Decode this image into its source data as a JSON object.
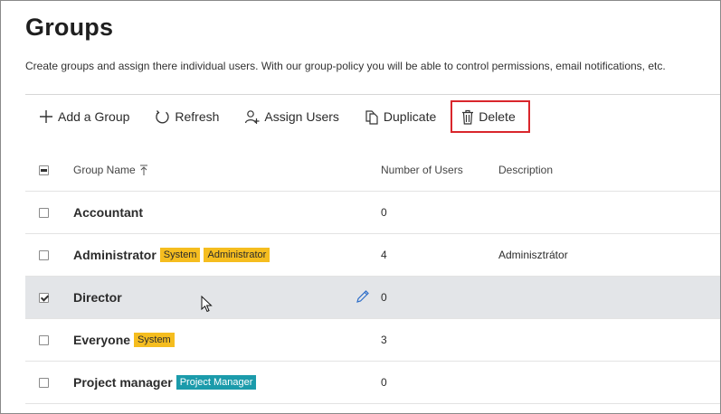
{
  "page": {
    "title": "Groups",
    "subtitle": "Create groups and assign there individual users. With our group-policy you will be able to control permissions, email notifications, etc."
  },
  "toolbar": {
    "add_label": "Add a Group",
    "refresh_label": "Refresh",
    "assign_label": "Assign Users",
    "duplicate_label": "Duplicate",
    "delete_label": "Delete"
  },
  "table": {
    "headers": {
      "name": "Group Name",
      "users": "Number of Users",
      "description": "Description"
    },
    "rows": [
      {
        "name": "Accountant",
        "users": "0",
        "description": "",
        "badges": []
      },
      {
        "name": "Administrator",
        "users": "4",
        "description": "Adminisztrátor",
        "badges": [
          {
            "text": "System",
            "color": "#f5bd1f"
          },
          {
            "text": "Administrator",
            "color": "#f5bd1f"
          }
        ]
      },
      {
        "name": "Director",
        "users": "0",
        "description": "",
        "badges": [],
        "selected": true
      },
      {
        "name": "Everyone",
        "users": "3",
        "description": "",
        "badges": [
          {
            "text": "System",
            "color": "#f5bd1f"
          }
        ]
      },
      {
        "name": "Project manager",
        "users": "0",
        "description": "",
        "badges": [
          {
            "text": "Project Manager",
            "color": "#1b9bab"
          }
        ]
      }
    ]
  },
  "colors": {
    "highlight_border": "#d9262c",
    "selected_row": "#e3e5e8",
    "badge_yellow": "#f5bd1f",
    "badge_teal": "#1b9bab",
    "edit_icon": "#2f6fc9"
  },
  "icons": {
    "add": "plus-icon",
    "refresh": "refresh-icon",
    "assign": "user-add-icon",
    "duplicate": "duplicate-icon",
    "delete": "trash-icon",
    "sort": "sort-ascending-icon",
    "edit": "pencil-icon",
    "cursor": "mouse-cursor-icon"
  }
}
